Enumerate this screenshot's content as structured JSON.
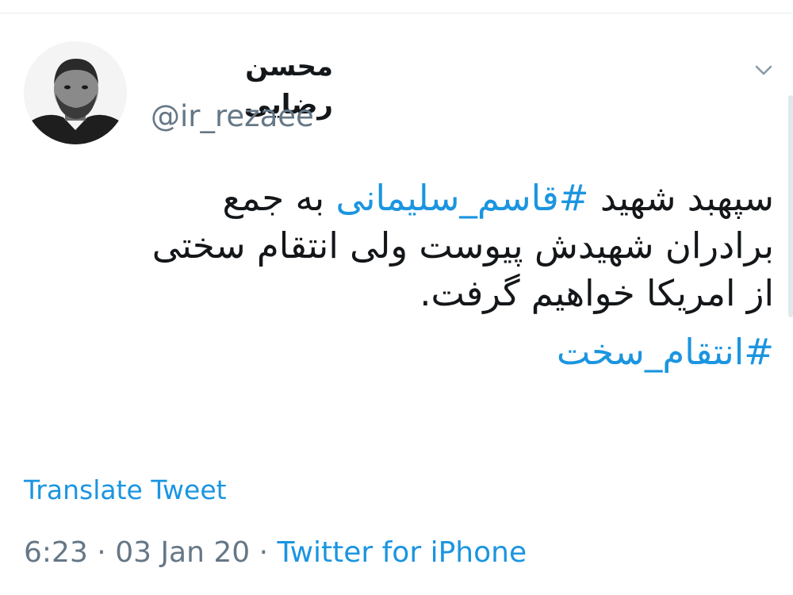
{
  "user": {
    "display_name": "محسن رضایی",
    "handle": "@ir_rezaee",
    "avatar_icon": "profile-photo",
    "menu_icon": "chevron-down-icon"
  },
  "tweet": {
    "line1": {
      "before": "سپهبد شهید ",
      "hashtag": "#قاسم_سلیمانی",
      "after": " به جمع"
    },
    "line2": "برادران شهیدش پیوست ولی انتقام سختی",
    "line3": "از امریکا خواهیم گرفت.",
    "hashtag_line": "#انتقام_سخت"
  },
  "translate_label": "Translate Tweet",
  "meta": {
    "time": "6:23",
    "separator": " · ",
    "date": "03 Jan 20",
    "separator2": " · ",
    "source": "Twitter for iPhone"
  },
  "colors": {
    "link": "#1b95e0",
    "text": "#14171a",
    "secondary": "#657786"
  }
}
